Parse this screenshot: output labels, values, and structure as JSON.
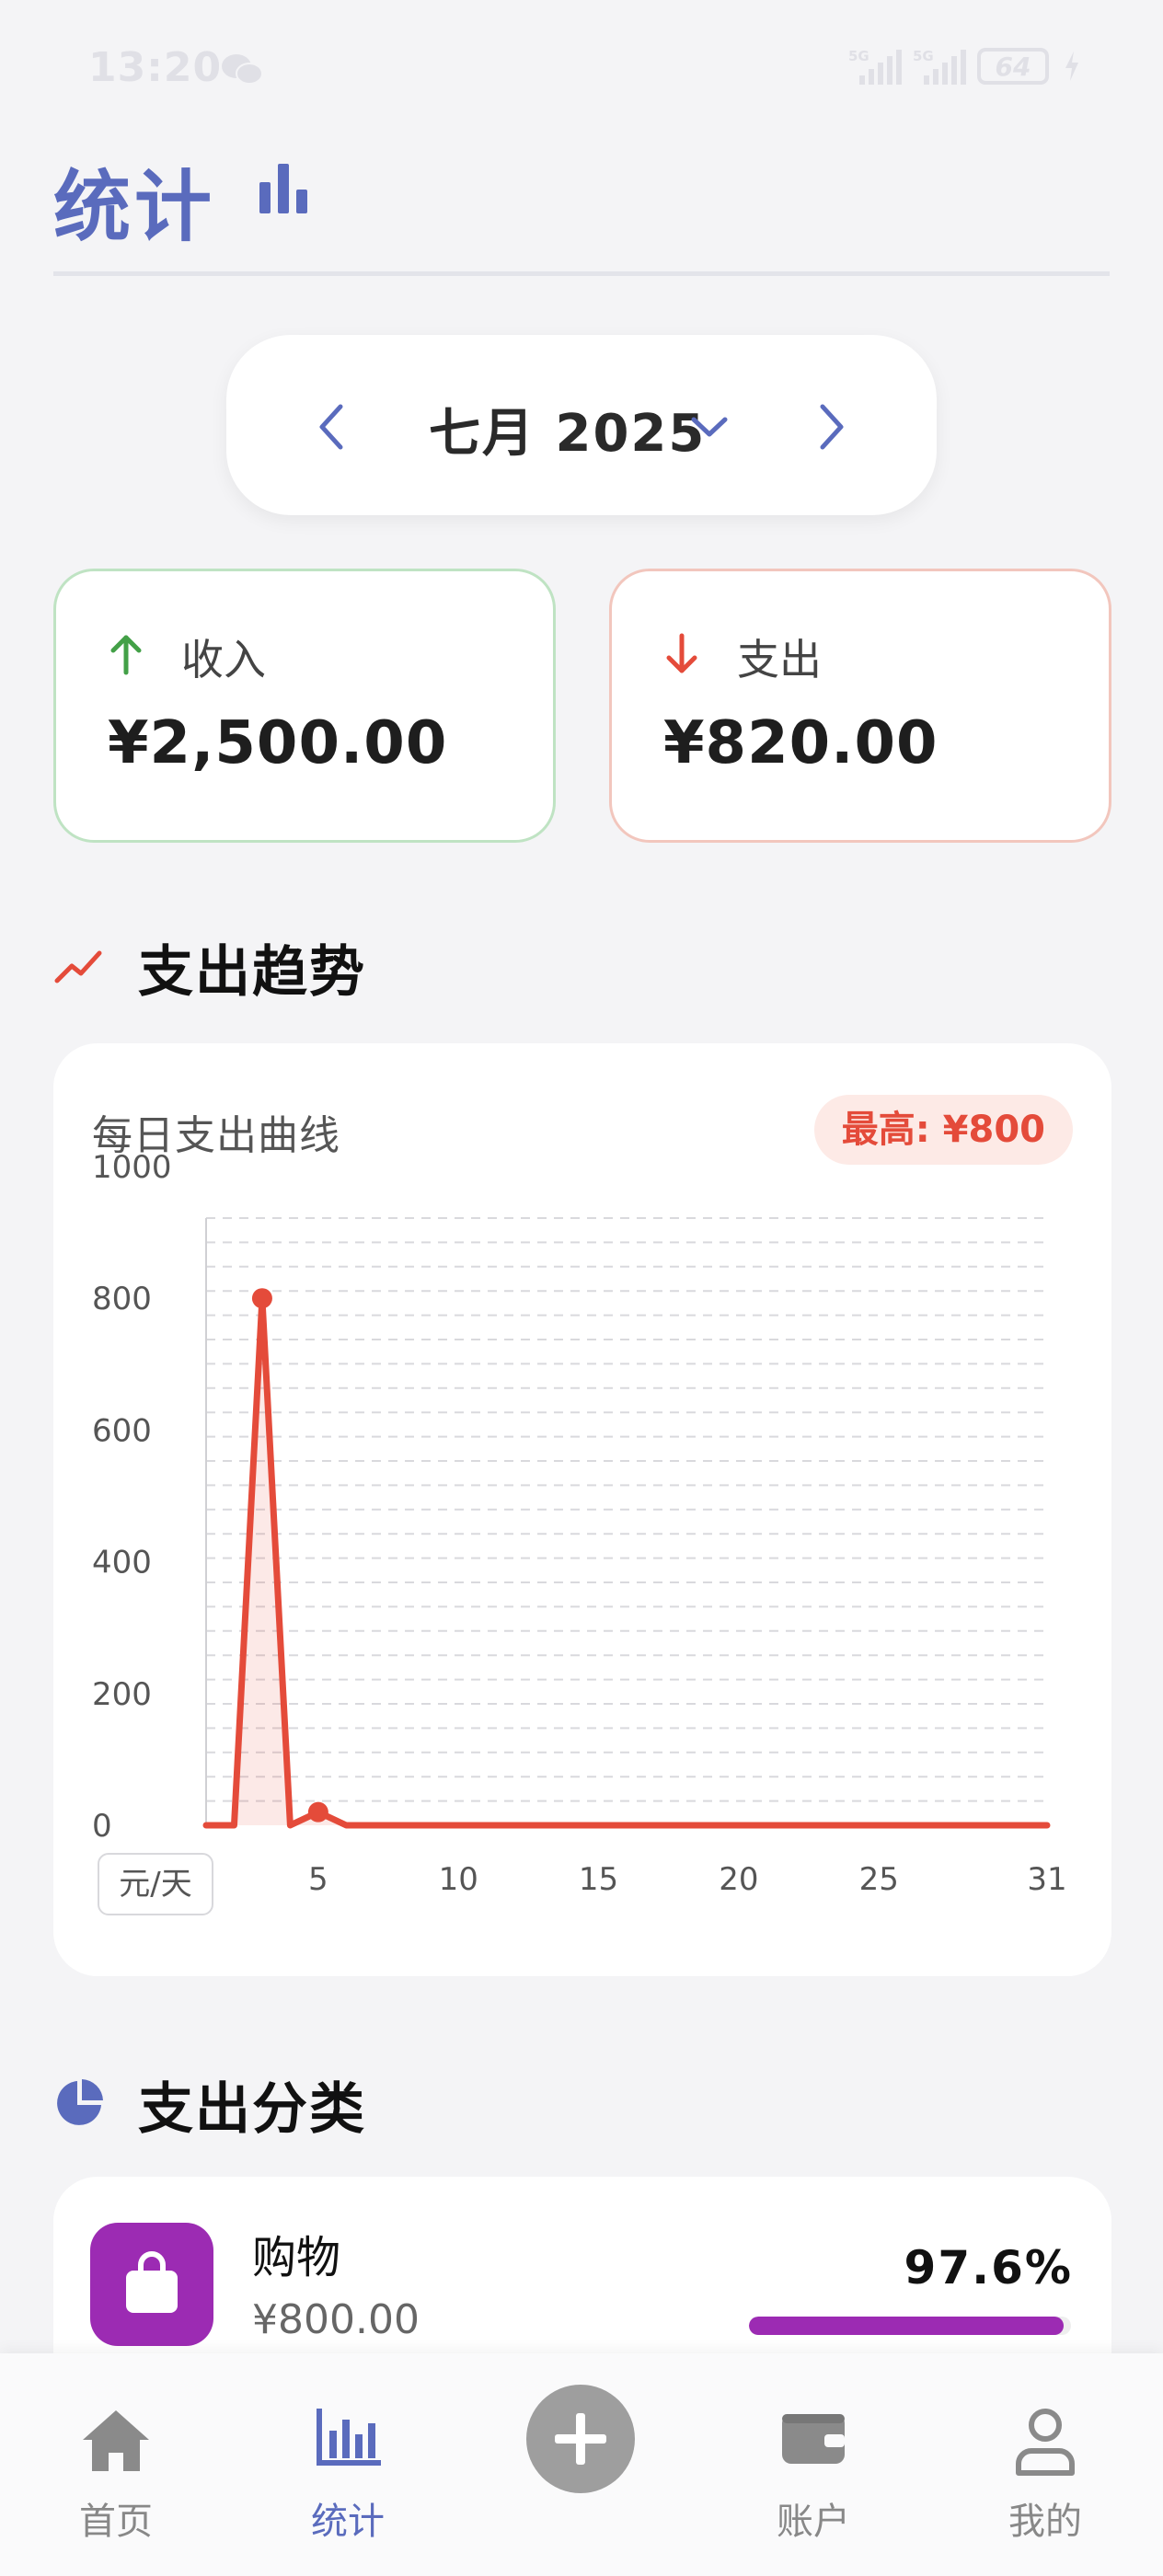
{
  "status_bar": {
    "time": "13:20",
    "net1": "5G",
    "net2": "5G",
    "battery": "64"
  },
  "header": {
    "title": "统计"
  },
  "month_selector": {
    "label": "七月 2025"
  },
  "summary": {
    "income": {
      "label": "收入",
      "amount": "¥2,500.00"
    },
    "expense": {
      "label": "支出",
      "amount": "¥820.00"
    }
  },
  "trend_section": {
    "title": "支出趋势",
    "subtitle": "每日支出曲线",
    "max_badge": "最高: ¥800",
    "unit": "元/天"
  },
  "category_section": {
    "title": "支出分类",
    "items": [
      {
        "name": "购物",
        "amount": "¥800.00",
        "percent": "97.6%",
        "share": 0.976,
        "color": "#9c2bb3"
      }
    ]
  },
  "bottom_nav": {
    "items": [
      {
        "label": "首页"
      },
      {
        "label": "统计"
      },
      {
        "label": "账户"
      },
      {
        "label": "我的"
      }
    ]
  },
  "colors": {
    "accent": "#5a6bbd",
    "expense": "#e44b3a",
    "income": "#43a047",
    "shopping": "#9c2bb3"
  },
  "chart_data": {
    "type": "line",
    "x": [
      1,
      2,
      3,
      4,
      5,
      6,
      7,
      8,
      9,
      10,
      11,
      12,
      13,
      14,
      15,
      16,
      17,
      18,
      19,
      20,
      21,
      22,
      23,
      24,
      25,
      26,
      27,
      28,
      29,
      30,
      31
    ],
    "series": [
      {
        "values": [
          0,
          0,
          800,
          0,
          20,
          0,
          0,
          0,
          0,
          0,
          0,
          0,
          0,
          0,
          0,
          0,
          0,
          0,
          0,
          0,
          0,
          0,
          0,
          0,
          0,
          0,
          0,
          0,
          0,
          0,
          0
        ]
      }
    ],
    "highlighted_points": [
      3,
      5
    ],
    "xticks": [
      5,
      10,
      15,
      20,
      25,
      31
    ],
    "yticks": [
      0,
      200,
      400,
      600,
      800,
      1000
    ],
    "xlim": [
      1,
      31
    ],
    "ylim": [
      0,
      1000
    ],
    "grid": true,
    "color": "#e44b3a"
  }
}
